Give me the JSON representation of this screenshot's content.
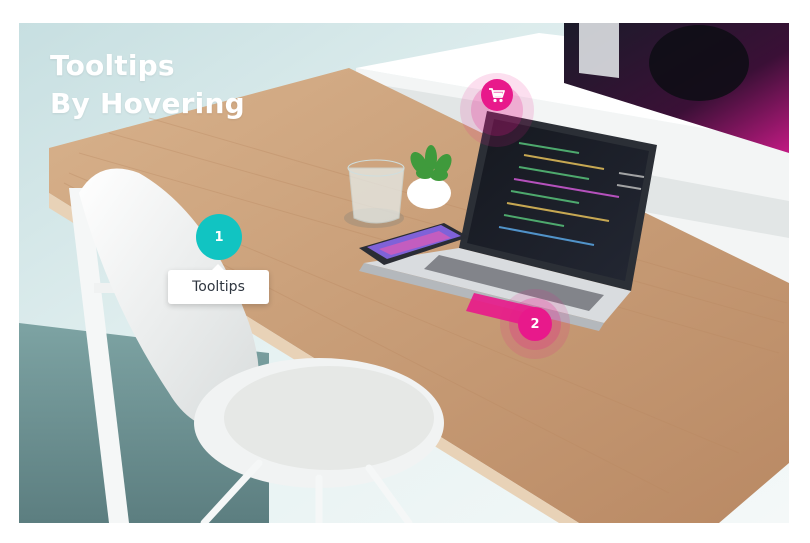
{
  "heading": {
    "line1": "Tooltips",
    "line2": "By Hovering"
  },
  "hotspots": [
    {
      "label": "1",
      "color": "#11c4c2",
      "tooltip": "Tooltips"
    },
    {
      "label": "2",
      "color": "#e8198b"
    }
  ],
  "cart_hotspot": {
    "icon": "shopping-cart-icon",
    "color": "#e8198b"
  },
  "colors": {
    "accent_teal": "#11c4c2",
    "accent_pink": "#e8198b",
    "desk": "#c89d77",
    "wall": "#dfeff0"
  }
}
